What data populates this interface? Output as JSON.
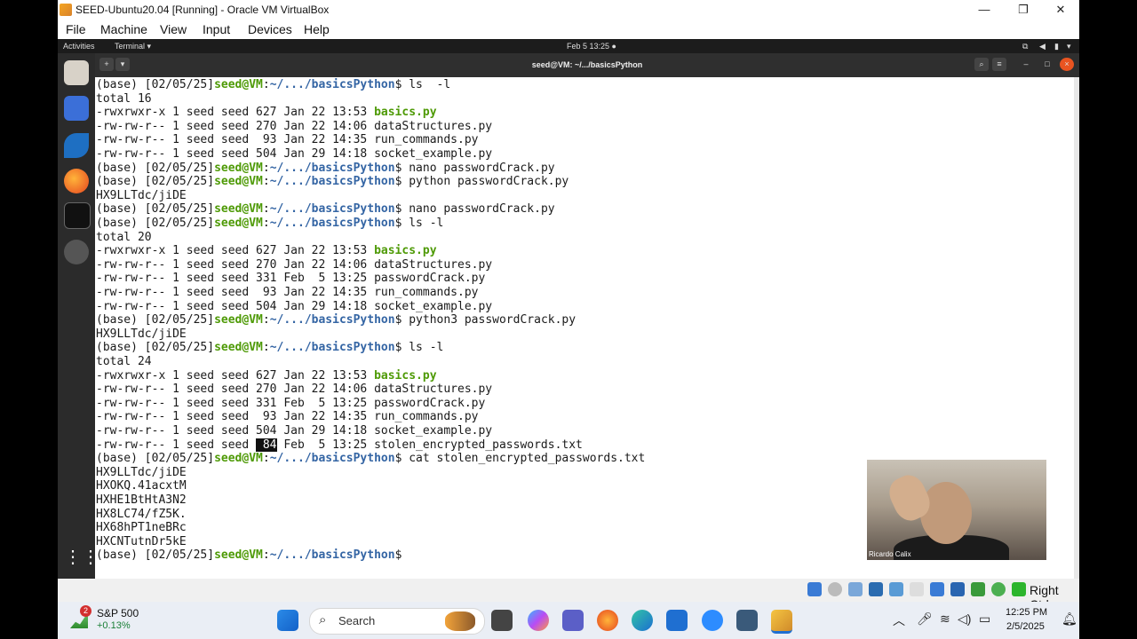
{
  "window": {
    "title": "SEED-Ubuntu20.04 [Running] - Oracle VM VirtualBox",
    "min": "—",
    "max": "❐",
    "close": "✕"
  },
  "menu": [
    "File",
    "Machine",
    "View",
    "Input",
    "Devices",
    "Help"
  ],
  "gnome": {
    "activities": "Activities",
    "app": "Terminal ▾",
    "clock": "Feb 5  13:25  ●"
  },
  "terminal": {
    "title": "seed@VM: ~/.../basicsPython",
    "prompt": {
      "pre": "(base) [02/05/25]",
      "user": "seed@VM",
      "colon": ":",
      "path": "~/.../basicsPython",
      "end": "$"
    },
    "lines": [
      {
        "t": "prompt",
        "cmd": " ls  -l"
      },
      {
        "t": "text",
        "v": "total 16"
      },
      {
        "t": "file",
        "pre": "-rwxrwxr-x 1 seed seed 627 Jan 22 13:53 ",
        "name": "basics.py",
        "exec": true
      },
      {
        "t": "file",
        "pre": "-rw-rw-r-- 1 seed seed 270 Jan 22 14:06 ",
        "name": "dataStructures.py"
      },
      {
        "t": "file",
        "pre": "-rw-rw-r-- 1 seed seed  93 Jan 22 14:35 ",
        "name": "run_commands.py"
      },
      {
        "t": "file",
        "pre": "-rw-rw-r-- 1 seed seed 504 Jan 29 14:18 ",
        "name": "socket_example.py"
      },
      {
        "t": "prompt",
        "cmd": " nano passwordCrack.py"
      },
      {
        "t": "prompt",
        "cmd": " python passwordCrack.py"
      },
      {
        "t": "text",
        "v": "HX9LLTdc/jiDE"
      },
      {
        "t": "prompt",
        "cmd": " nano passwordCrack.py"
      },
      {
        "t": "prompt",
        "cmd": " ls -l"
      },
      {
        "t": "text",
        "v": "total 20"
      },
      {
        "t": "file",
        "pre": "-rwxrwxr-x 1 seed seed 627 Jan 22 13:53 ",
        "name": "basics.py",
        "exec": true
      },
      {
        "t": "file",
        "pre": "-rw-rw-r-- 1 seed seed 270 Jan 22 14:06 ",
        "name": "dataStructures.py"
      },
      {
        "t": "file",
        "pre": "-rw-rw-r-- 1 seed seed 331 Feb  5 13:25 ",
        "name": "passwordCrack.py"
      },
      {
        "t": "file",
        "pre": "-rw-rw-r-- 1 seed seed  93 Jan 22 14:35 ",
        "name": "run_commands.py"
      },
      {
        "t": "file",
        "pre": "-rw-rw-r-- 1 seed seed 504 Jan 29 14:18 ",
        "name": "socket_example.py"
      },
      {
        "t": "prompt",
        "cmd": " python3 passwordCrack.py"
      },
      {
        "t": "text",
        "v": "HX9LLTdc/jiDE"
      },
      {
        "t": "prompt",
        "cmd": " ls -l"
      },
      {
        "t": "text",
        "v": "total 24"
      },
      {
        "t": "file",
        "pre": "-rwxrwxr-x 1 seed seed 627 Jan 22 13:53 ",
        "name": "basics.py",
        "exec": true
      },
      {
        "t": "file",
        "pre": "-rw-rw-r-- 1 seed seed 270 Jan 22 14:06 ",
        "name": "dataStructures.py"
      },
      {
        "t": "file",
        "pre": "-rw-rw-r-- 1 seed seed 331 Feb  5 13:25 ",
        "name": "passwordCrack.py"
      },
      {
        "t": "file",
        "pre": "-rw-rw-r-- 1 seed seed  93 Jan 22 14:35 ",
        "name": "run_commands.py"
      },
      {
        "t": "file",
        "pre": "-rw-rw-r-- 1 seed seed 504 Jan 29 14:18 ",
        "name": "socket_example.py"
      },
      {
        "t": "filehl",
        "pre": "-rw-rw-r-- 1 seed seed ",
        "hl": " 84",
        "post": " Feb  5 13:25 ",
        "name": "stolen_encrypted_passwords.txt"
      },
      {
        "t": "prompt",
        "cmd": " cat stolen_encrypted_passwords.txt"
      },
      {
        "t": "text",
        "v": "HX9LLTdc/jiDE"
      },
      {
        "t": "text",
        "v": "HXOKQ.41acxtM"
      },
      {
        "t": "text",
        "v": "HXHE1BtHtA3N2"
      },
      {
        "t": "text",
        "v": "HX8LC74/fZ5K."
      },
      {
        "t": "text",
        "v": "HX68hPT1neBRc"
      },
      {
        "t": "text",
        "v": "HXCNTutnDr5kE"
      },
      {
        "t": "prompt",
        "cmd": ""
      }
    ]
  },
  "webcam": {
    "label": "Ricardo Calix"
  },
  "vbox_status": {
    "host_key": "Right Ctrl"
  },
  "taskbar": {
    "stock_name": "S&P 500",
    "stock_change": "+0.13%",
    "stock_badge": "2",
    "search": "Search",
    "time": "12:25 PM",
    "date": "2/5/2025"
  },
  "colors": {
    "exec": "#4e9a06",
    "path": "#3465a4",
    "user": "#4e9a06"
  }
}
